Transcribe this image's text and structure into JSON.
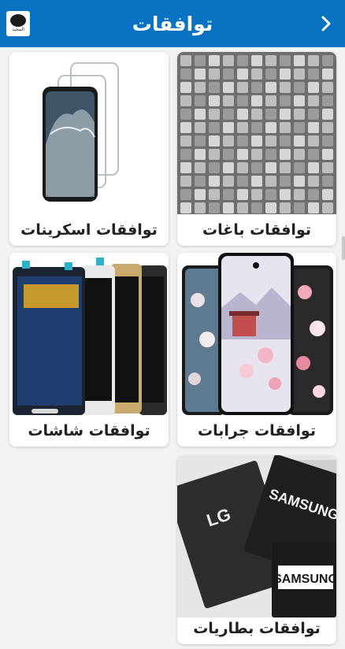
{
  "header": {
    "title": "توافقات",
    "logo_text": "المجيد"
  },
  "categories": [
    {
      "label": "توافقات باغات",
      "image": "phone-cases-stock-photo"
    },
    {
      "label": "توافقات اسكرينات",
      "image": "screen-protector-photo"
    },
    {
      "label": "توافقات جرابات",
      "image": "floral-phone-covers-photo"
    },
    {
      "label": "توافقات شاشات",
      "image": "lcd-screens-photo"
    },
    {
      "label": "توافقات بطاريات",
      "image": "phone-batteries-photo",
      "brands": [
        "LG",
        "SAMSUNG",
        "SAMSUNG"
      ]
    }
  ]
}
